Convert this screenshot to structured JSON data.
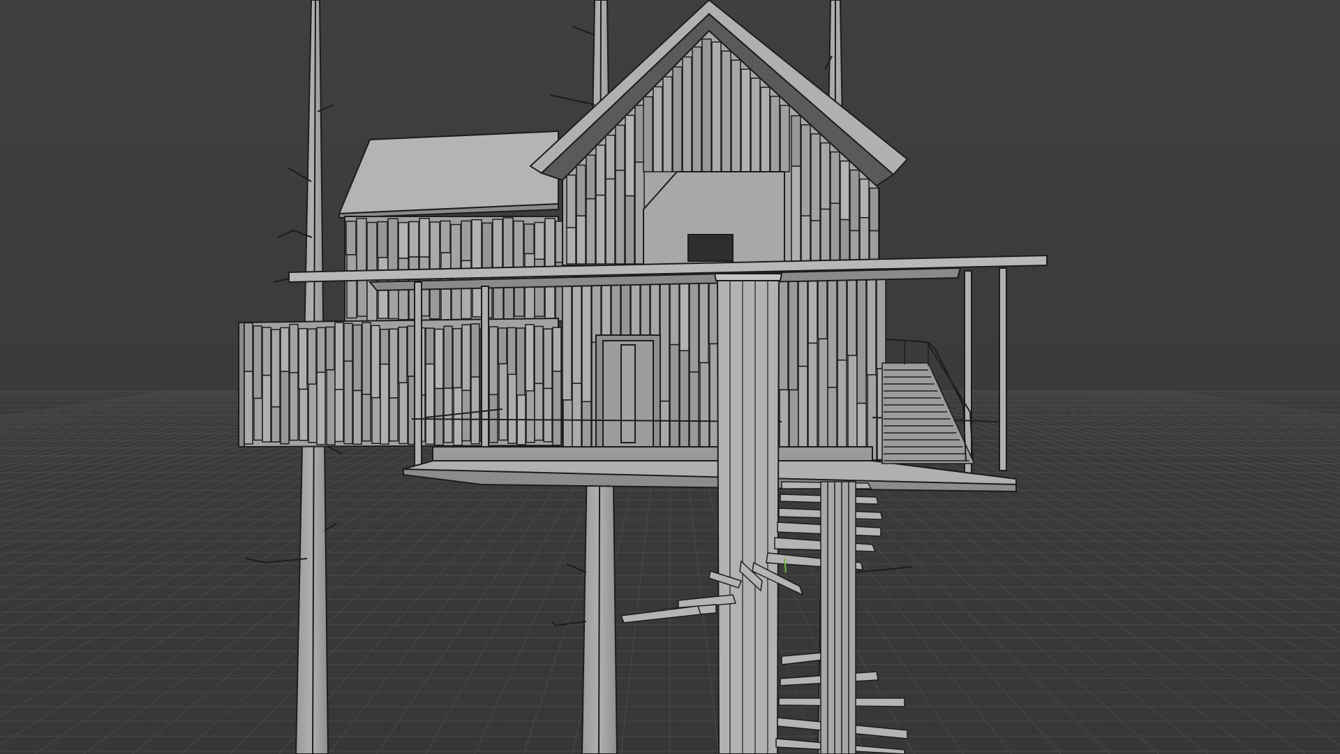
{
  "app": {
    "name": "3D Viewport",
    "mode": "solid-shading"
  },
  "viewport": {
    "background_color": "#3d3d3d",
    "grid_color": "#4a4a4a",
    "model_face_color": "#a4a4a4",
    "model_shadow_color": "#8c8c8c",
    "model_edge_color": "#1c1c1c",
    "stair_accent_color": "#6cbc3c"
  },
  "scene": {
    "object": "treehouse",
    "visible_parts": [
      "tree-trunk-left",
      "tree-trunk-mid",
      "tree-trunk-back",
      "tree-trunk-front",
      "house-main-gable",
      "house-side-wing",
      "wraparound-deck",
      "deck-railing",
      "spiral-staircase",
      "rear-staircase",
      "doorway",
      "window"
    ]
  }
}
